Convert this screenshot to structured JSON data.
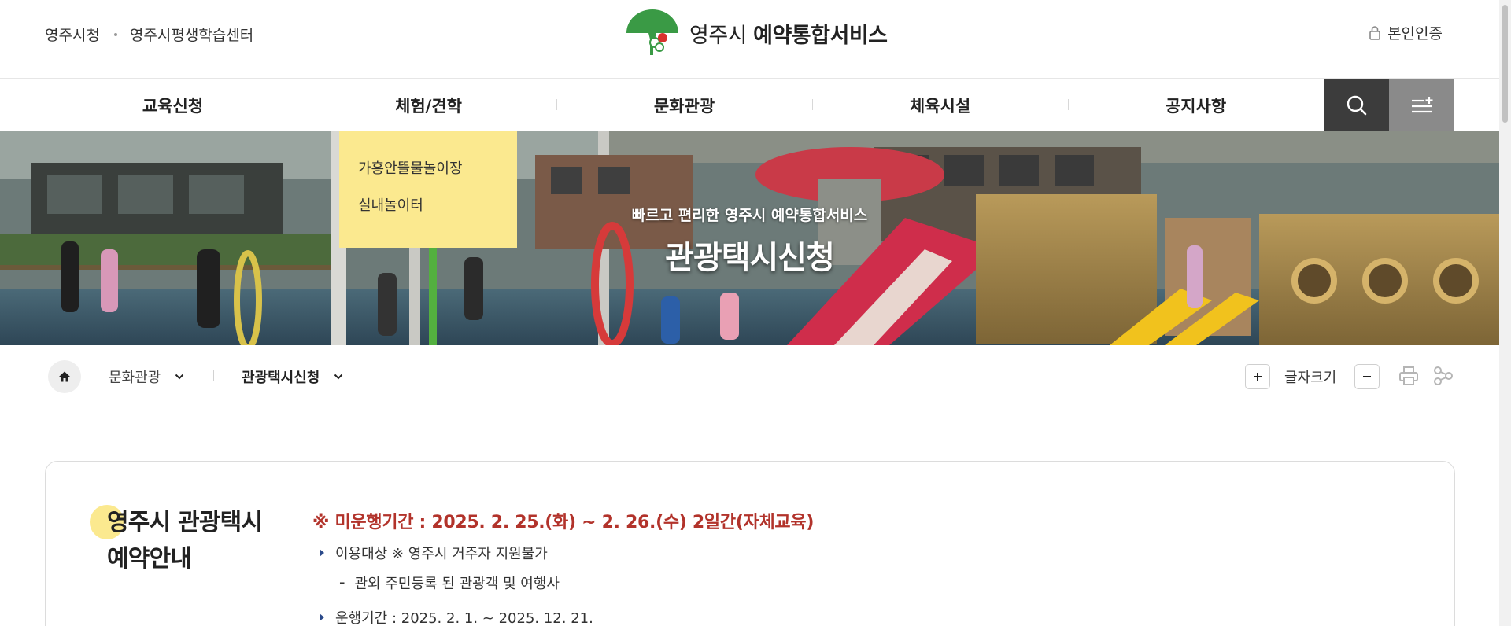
{
  "top_links": [
    "영주시청",
    "영주시평생학습센터"
  ],
  "logo": {
    "city": "영주시",
    "service": "예약통합서비스"
  },
  "auth_label": "본인인증",
  "gnb": [
    "교육신청",
    "체험/견학",
    "문화관광",
    "체육시설",
    "공지사항"
  ],
  "dropdown": [
    "가흥안뜰물놀이장",
    "실내놀이터"
  ],
  "banner": {
    "subtitle": "빠르고 편리한 영주시 예약통합서비스",
    "title": "관광택시신청"
  },
  "breadcrumb": {
    "level1": "문화관광",
    "level2": "관광택시신청"
  },
  "font_size_label": "글자크기",
  "info": {
    "title_line1": "영주시 관광택시",
    "title_line2": "예약안내",
    "notice": "※ 미운행기간 : 2025. 2. 25.(화) ~ 2. 26.(수) 2일간(자체교육)",
    "target": "이용대상 ※ 영주시 거주자 지원불가",
    "target_detail": "관외 주민등록 된 관광객 및 여행사",
    "period": "운행기간 : 2025. 2. 1. ~ 2025. 12. 21."
  },
  "colors": {
    "accent_yellow": "#fbe98f",
    "notice_red": "#b2332b",
    "logo_green": "#3a9a45",
    "search_bg": "#3c3c3c",
    "allmenu_bg": "#8a8a8a"
  }
}
